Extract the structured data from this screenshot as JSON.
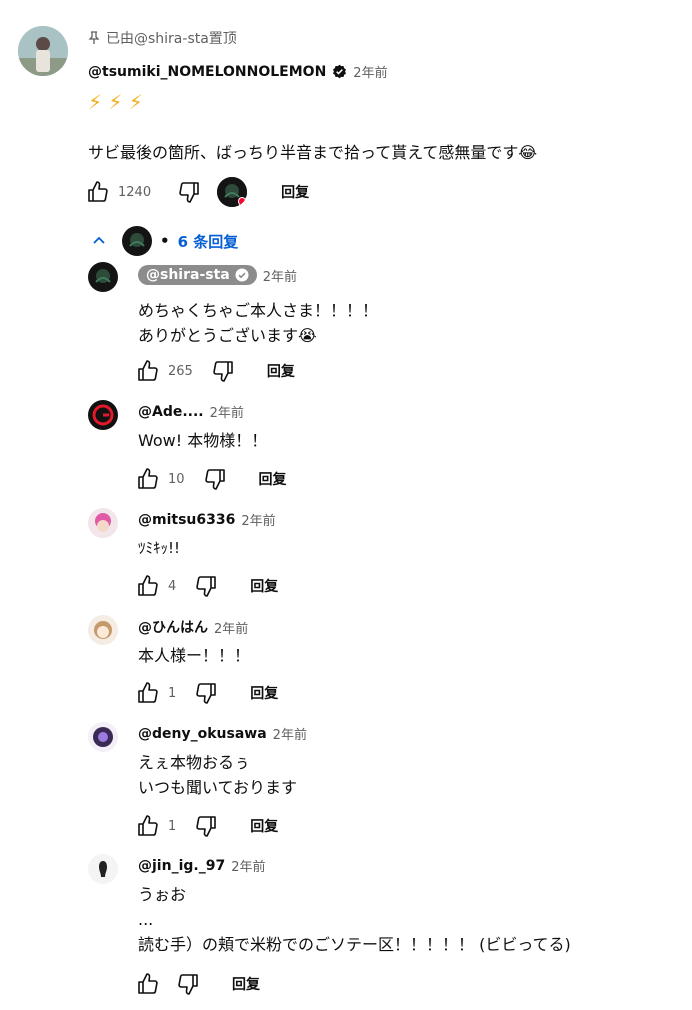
{
  "pinned": {
    "pin_text": "已由@shira-sta置顶",
    "author": "@tsumiki_NOMELONNOLEMON",
    "time": "2年前",
    "emoji_line": "⚡ ⚡ ⚡",
    "text": "サビ最後の箇所、ばっちり半音まで拾って貰えて感無量です😂",
    "likes": "1240",
    "reply_label": "回复"
  },
  "replies_toggle": {
    "label": "6 条回复",
    "dot": "•"
  },
  "replies": [
    {
      "author": "@shira-sta",
      "time": "2年前",
      "text": "めちゃくちゃご本人さま！！！！\nありがとうございます😭",
      "likes": "265",
      "reply_label": "回复"
    },
    {
      "author": "@Ade....",
      "time": "2年前",
      "text": "Wow! 本物様！！",
      "likes": "10",
      "reply_label": "回复"
    },
    {
      "author": "@mitsu6336",
      "time": "2年前",
      "text": "ﾂﾐｷｯ!!",
      "likes": "4",
      "reply_label": "回复"
    },
    {
      "author": "@ひんはん",
      "time": "2年前",
      "text": "本人様ー！！！",
      "likes": "1",
      "reply_label": "回复"
    },
    {
      "author": "@deny_okusawa",
      "time": "2年前",
      "text": "えぇ本物おるぅ\nいつも聞いております",
      "likes": "1",
      "reply_label": "回复"
    },
    {
      "author": "@jin_ig._97",
      "time": "2年前",
      "text": "うぉお\n...\n読む手）の頬で米粉でのごソテー区！！！！！ (ビビってる)",
      "likes": "",
      "reply_label": "回复"
    }
  ],
  "colors": {
    "accent": "#065fd4",
    "heart": "#ff0033",
    "muted": "#606060"
  }
}
